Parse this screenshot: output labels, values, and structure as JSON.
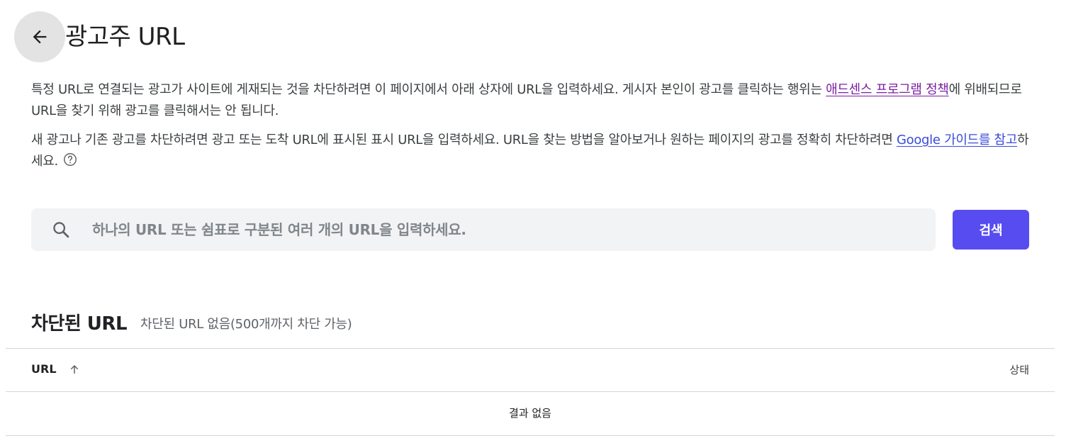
{
  "header": {
    "back_icon": "arrow-left-icon",
    "title": "광고주 URL"
  },
  "description": {
    "p1_text": "특정 URL로 연결되는 광고가 사이트에 게재되는 것을 차단하려면 이 페이지에서 아래 상자에 URL을 입력하세요. 게시자 본인이 광고를 클릭하는 행위는 ",
    "p1_link": "애드센스 프로그램 정책",
    "p1_after": "에 위배되므로 URL을 찾기 위해 광고를 클릭해서는 안 됩니다.",
    "p2_text": "새 광고나 기존 광고를 차단하려면 광고 또는 도착 URL에 표시된 표시 URL을 입력하세요. URL을 찾는 방법을 알아보거나 원하는 페이지의 광고를 정확히 차단하려면 ",
    "p2_link": "Google 가이드를 참고",
    "p2_after": "하세요.",
    "help_icon": "help-circle-icon"
  },
  "search": {
    "icon": "search-icon",
    "placeholder": "하나의 URL 또는 쉼표로 구분된 여러 개의 URL을 입력하세요.",
    "value": "",
    "button_label": "검색"
  },
  "blocked": {
    "title": "차단된 URL",
    "subtitle": "차단된 URL 없음(500개까지 차단 가능)"
  },
  "table": {
    "col_url": "URL",
    "sort_icon": "arrow-up-icon",
    "col_status": "상태",
    "empty_text": "결과 없음"
  },
  "colors": {
    "accent": "#574cf0",
    "visited_link": "#7b1fa2",
    "link": "#3b4bd9",
    "search_bg": "#f1f3f4"
  }
}
